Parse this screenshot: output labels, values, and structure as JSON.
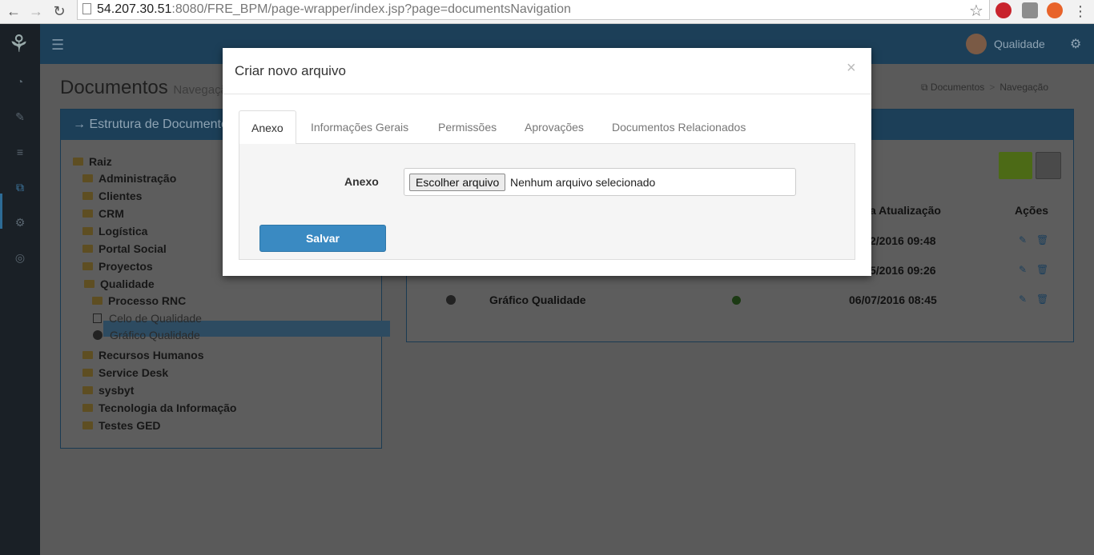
{
  "browser": {
    "url_host": "54.207.30.51",
    "url_rest": ":8080/FRE_BPM/page-wrapper/index.jsp?page=documentsNavigation"
  },
  "topbar": {
    "user_name": "Qualidade"
  },
  "page": {
    "title": "Documentos",
    "subtitle": "Navegação",
    "breadcrumb": [
      "Documentos",
      "Navegação"
    ]
  },
  "tree": {
    "header": "Estrutura de Documentos",
    "root": "Raiz",
    "folders_top": [
      "Administração",
      "Clientes",
      "CRM",
      "Logística",
      "Portal Social",
      "Proyectos"
    ],
    "selected": "Qualidade",
    "children": {
      "folder": "Processo RNC",
      "file1": "Celo de Qualidade",
      "file2": "Gráfico Qualidade"
    },
    "folders_bottom": [
      "Recursos Humanos",
      "Service Desk",
      "sysbyt",
      "Tecnologia da Informação",
      "Testes GED"
    ]
  },
  "table": {
    "col_update": "a Atualização",
    "col_actions": "Ações",
    "rows": [
      {
        "name": "",
        "date": "2/2016 09:48"
      },
      {
        "name": "",
        "date": "5/2016 09:26"
      },
      {
        "name": "Gráfico Qualidade",
        "date": "06/07/2016 08:45"
      }
    ]
  },
  "modal": {
    "title": "Criar novo arquivo",
    "close": "×",
    "tabs": [
      "Anexo",
      "Informações Gerais",
      "Permissões",
      "Aprovações",
      "Documentos Relacionados"
    ],
    "active_tab": "Anexo",
    "field_label": "Anexo",
    "file_button": "Escolher arquivo",
    "file_status": "Nenhum arquivo selecionado",
    "save": "Salvar"
  },
  "colors": {
    "primary_button": "#3a8ac2",
    "header_dark": "#1c3f58",
    "success_button": "#4c6a16"
  }
}
